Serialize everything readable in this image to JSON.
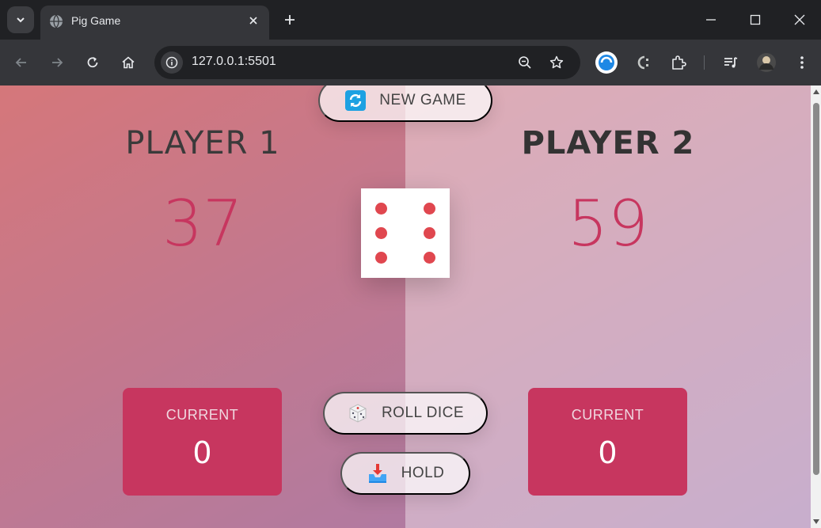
{
  "browser": {
    "tab_title": "Pig Game",
    "url": "127.0.0.1:5501"
  },
  "game": {
    "new_game_label": "NEW GAME",
    "roll_dice_label": "ROLL DICE",
    "hold_label": "HOLD",
    "dice_value": 6,
    "players": [
      {
        "name": "PLAYER 1",
        "score": "37",
        "current_label": "CURRENT",
        "current_score": "0",
        "active": false
      },
      {
        "name": "PLAYER 2",
        "score": "59",
        "current_label": "CURRENT",
        "current_score": "0",
        "active": true
      }
    ]
  },
  "colors": {
    "accent": "#c7365f",
    "pip": "#e0474f"
  }
}
